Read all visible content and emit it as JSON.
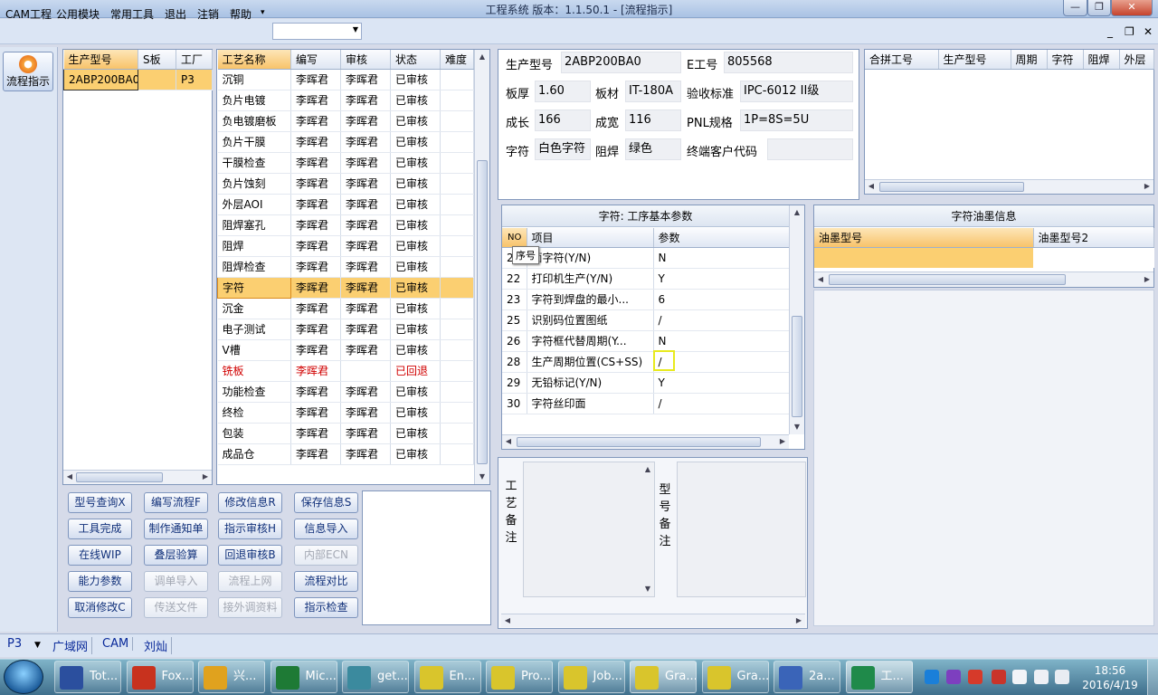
{
  "window": {
    "title": "工程系统    版本：1.1.50.1 - [流程指示]"
  },
  "menu": {
    "items": [
      "CAM工程",
      "公用模块",
      "常用工具",
      "退出",
      "注销",
      "帮助"
    ],
    "help_arrow": "▾",
    "combo_value": ""
  },
  "rail": {
    "flow_label": "流程指示"
  },
  "model_list": {
    "headers": [
      "生产型号",
      "S板",
      "工厂"
    ],
    "rows": [
      [
        "2ABP200BA0",
        "",
        "P3"
      ]
    ]
  },
  "process_list": {
    "headers": [
      "工艺名称",
      "编写",
      "审核",
      "状态",
      "难度"
    ],
    "rows": [
      [
        "沉铜",
        "李晖君",
        "李晖君",
        "已审核",
        ""
      ],
      [
        "负片电镀",
        "李晖君",
        "李晖君",
        "已审核",
        ""
      ],
      [
        "负电镀磨板",
        "李晖君",
        "李晖君",
        "已审核",
        ""
      ],
      [
        "负片干膜",
        "李晖君",
        "李晖君",
        "已审核",
        ""
      ],
      [
        "干膜检查",
        "李晖君",
        "李晖君",
        "已审核",
        ""
      ],
      [
        "负片蚀刻",
        "李晖君",
        "李晖君",
        "已审核",
        ""
      ],
      [
        "外层AOI",
        "李晖君",
        "李晖君",
        "已审核",
        ""
      ],
      [
        "阻焊塞孔",
        "李晖君",
        "李晖君",
        "已审核",
        ""
      ],
      [
        "阻焊",
        "李晖君",
        "李晖君",
        "已审核",
        ""
      ],
      [
        "阻焊检查",
        "李晖君",
        "李晖君",
        "已审核",
        ""
      ],
      [
        "字符",
        "李晖君",
        "李晖君",
        "已审核",
        ""
      ],
      [
        "沉金",
        "李晖君",
        "李晖君",
        "已审核",
        ""
      ],
      [
        "电子测试",
        "李晖君",
        "李晖君",
        "已审核",
        ""
      ],
      [
        "V槽",
        "李晖君",
        "李晖君",
        "已审核",
        ""
      ],
      [
        "铣板",
        "李晖君",
        "",
        "已回退",
        ""
      ],
      [
        "功能检查",
        "李晖君",
        "李晖君",
        "已审核",
        ""
      ],
      [
        "终检",
        "李晖君",
        "李晖君",
        "已审核",
        ""
      ],
      [
        "包装",
        "李晖君",
        "李晖君",
        "已审核",
        ""
      ],
      [
        "成品仓",
        "李晖君",
        "李晖君",
        "已审核",
        ""
      ]
    ]
  },
  "buttons": [
    {
      "label": "型号查询X",
      "enabled": true
    },
    {
      "label": "编写流程F",
      "enabled": true
    },
    {
      "label": "修改信息R",
      "enabled": true
    },
    {
      "label": "保存信息S",
      "enabled": true
    },
    {
      "label": "工具完成",
      "enabled": true
    },
    {
      "label": "制作通知单",
      "enabled": true
    },
    {
      "label": "指示审核H",
      "enabled": true
    },
    {
      "label": "信息导入",
      "enabled": true
    },
    {
      "label": "在线WIP",
      "enabled": true
    },
    {
      "label": "叠层验算",
      "enabled": true
    },
    {
      "label": "回退审核B",
      "enabled": true
    },
    {
      "label": "内部ECN",
      "enabled": false
    },
    {
      "label": "能力参数",
      "enabled": true
    },
    {
      "label": "调单导入",
      "enabled": false
    },
    {
      "label": "流程上网",
      "enabled": false
    },
    {
      "label": "流程对比",
      "enabled": true
    },
    {
      "label": "取消修改C",
      "enabled": true
    },
    {
      "label": "传送文件",
      "enabled": false
    },
    {
      "label": "接外调资料",
      "enabled": false
    },
    {
      "label": "指示检查",
      "enabled": true
    }
  ],
  "info": {
    "model_label": "生产型号",
    "model": "2ABP200BA0",
    "eno_label": "E工号",
    "eno": "805568",
    "thick_label": "板厚",
    "thick": "1.60",
    "material_label": "板材",
    "material": "IT-180A",
    "std_label": "验收标准",
    "std": "IPC-6012 II级",
    "len_label": "成长",
    "len": "166",
    "wid_label": "成宽",
    "wid": "116",
    "pnl_label": "PNL规格",
    "pnl": "1P=8S=5U",
    "char_label": "字符",
    "char": "白色字符",
    "mask_label": "阻焊",
    "mask": "绿色",
    "cust_label": "终端客户代码",
    "cust": ""
  },
  "combine_grid": {
    "headers": [
      "合拼工号",
      "生产型号",
      "周期",
      "字符",
      "阻焊",
      "外层"
    ]
  },
  "params": {
    "title": "字符: 工序基本参数",
    "headers": [
      "NO",
      "项目",
      "参数"
    ],
    "tooltip": "序号",
    "rows": [
      [
        "2",
        "面字符(Y/N)",
        "N"
      ],
      [
        "22",
        "打印机生产(Y/N)",
        "Y"
      ],
      [
        "23",
        "字符到焊盘的最小...",
        "6"
      ],
      [
        "25",
        "识别码位置图纸",
        "/"
      ],
      [
        "26",
        "字符框代替周期(Y...",
        "N"
      ],
      [
        "28",
        "生产周期位置(CS+SS)",
        "/"
      ],
      [
        "29",
        "无铅标记(Y/N)",
        "Y"
      ],
      [
        "30",
        "字符丝印面",
        "/"
      ]
    ]
  },
  "ink": {
    "title": "字符油墨信息",
    "headers": [
      "油墨型号",
      "油墨型号2"
    ]
  },
  "notes": {
    "process_label": "工艺备注",
    "model_label": "型号备注"
  },
  "status": {
    "factory": "P3",
    "network": "广域网",
    "dept": "CAM",
    "user": "刘灿"
  },
  "taskbar": {
    "tasks": [
      {
        "label": "Tot...",
        "color": "#2b4f9e"
      },
      {
        "label": "Fox...",
        "color": "#c8321e"
      },
      {
        "label": "兴...",
        "color": "#e0a21e"
      },
      {
        "label": "Mic...",
        "color": "#1e7a35"
      },
      {
        "label": "get...",
        "color": "#3b8a9e"
      },
      {
        "label": "En...",
        "color": "#d9c52c"
      },
      {
        "label": "Pro...",
        "color": "#d9c52c"
      },
      {
        "label": "Job...",
        "color": "#d9c52c"
      },
      {
        "label": "Gra...",
        "color": "#d9c52c"
      },
      {
        "label": "Gra...",
        "color": "#d9c52c"
      },
      {
        "label": "2a...",
        "color": "#3a64b8"
      },
      {
        "label": "工...",
        "color": "#1f8a4a"
      }
    ],
    "time": "18:56",
    "date": "2016/4/19"
  }
}
